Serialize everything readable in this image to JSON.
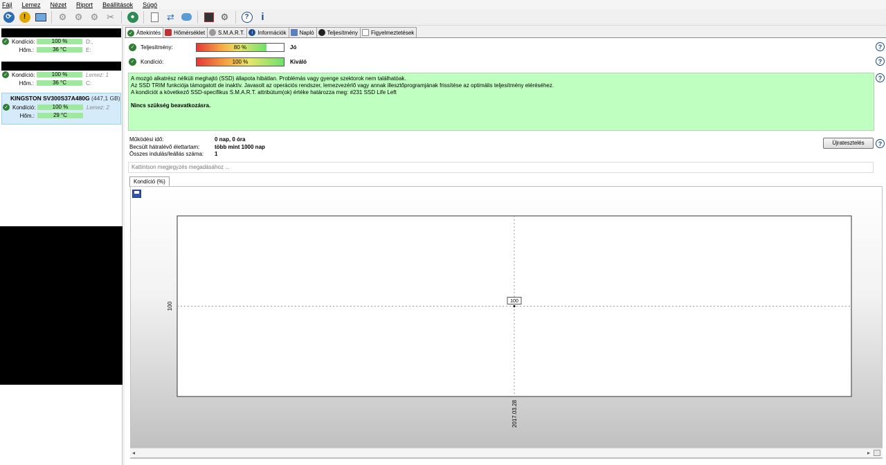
{
  "menu": [
    "Fájl",
    "Lemez",
    "Nézet",
    "Riport",
    "Beállítások",
    "Súgó"
  ],
  "disks": [
    {
      "condition_label": "Kondíció:",
      "condition": "100 %",
      "temp_label": "Hőm.:",
      "temp": "36 °C",
      "drive1": "D:,",
      "drive2": "E:"
    },
    {
      "condition_label": "Kondíció:",
      "condition": "100 %",
      "temp_label": "Hőm.:",
      "temp": "36 °C",
      "drive1": "Lemez: 1",
      "drive2": "C:"
    },
    {
      "name": "KINGSTON SV300S37A480G",
      "size": "(447,1 GB)",
      "condition_label": "Kondíció:",
      "condition": "100 %",
      "temp_label": "Hőm.:",
      "temp": "29 °C",
      "drive1": "Lemez: 2"
    }
  ],
  "tabs": [
    "Áttekintés",
    "Hőmérséklet",
    "S.M.A.R.T.",
    "Információk",
    "Napló",
    "Teljesítmény",
    "Figyelmeztetések"
  ],
  "overview": {
    "performance_label": "Teljesítmény:",
    "performance_value": 80,
    "performance_text": "80 %",
    "performance_verdict": "Jó",
    "condition_label": "Kondíció:",
    "condition_value": 100,
    "condition_text": "100 %",
    "condition_verdict": "Kiváló",
    "summary_lines": [
      "A mozgó alkatrész nélküli meghajtó (SSD) állapota hibátlan. Problémás vagy gyenge szektorok nem találhatóak.",
      "Az SSD TRIM funkciója támogatott de inaktív. Javasolt az operációs rendszer, lemezvezérlő vagy annak illesztőprogramjának frissítése az optimális teljesítmény eléréséhez.",
      "A kondíciót a következő SSD-specifikus S.M.A.R.T. attribútum(ok) értéke határozza meg: #231 SSD Life Left"
    ],
    "summary_bold": "Nincs szükség beavatkozásra.",
    "stats": [
      {
        "key": "Működési idő:",
        "value": "0 nap, 0 óra"
      },
      {
        "key": "Becsült hátralévő élettartam:",
        "value": "több mint 1000 nap"
      },
      {
        "key": "Összes indulás/leállás száma:",
        "value": "1"
      }
    ],
    "reset_button": "Újratesztelés",
    "note_placeholder": "Kattintson megjegyzés megadásához ...",
    "chart_tab": "Kondíció  (%)"
  },
  "chart_data": {
    "type": "scatter",
    "x": [
      "2017.03.28"
    ],
    "values": [
      100
    ],
    "y_tick_label": "100",
    "point_label": "100",
    "xlabel": "",
    "ylabel": ""
  },
  "colors": {
    "ok_green": "#2e7d32",
    "summary_bg": "#bfffbf",
    "selected_disk_bg": "#d5ebfa"
  }
}
